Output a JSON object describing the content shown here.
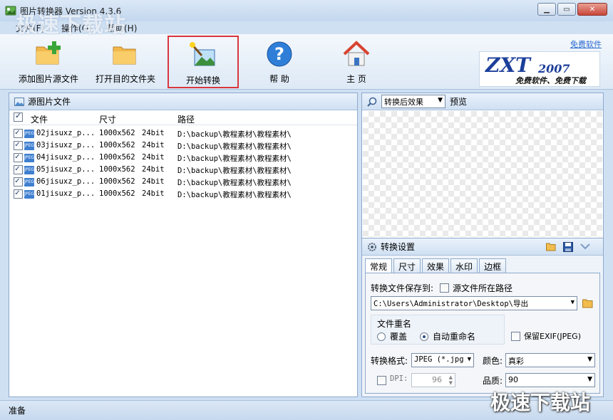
{
  "window": {
    "title": "图片转换器 Version 4.3.6"
  },
  "menu": {
    "file": "文件(F)",
    "operate": "操作(O)",
    "help": "帮助(H)"
  },
  "toolbar": {
    "add_source": "添加图片源文件",
    "open_target": "打开目的文件夹",
    "start_convert": "开始转换",
    "help": "帮 助",
    "home": "主 页",
    "free_link": "免费软件"
  },
  "logo": {
    "main": "ZXT",
    "year": "2007",
    "sub": "免费软件、免费下载"
  },
  "watermark": {
    "top": "极速下载站",
    "bottom": "极速下载站"
  },
  "source_panel": {
    "title": "源图片文件",
    "columns": {
      "file": "文件",
      "size": "尺寸",
      "path": "路径"
    },
    "rows": [
      {
        "checked": true,
        "icon": "jpeg-icon",
        "name": "02jisuxz_p...",
        "size": "1000x562",
        "depth": "24bit",
        "path": "D:\\backup\\教程素材\\教程素材\\"
      },
      {
        "checked": true,
        "icon": "jpeg-icon",
        "name": "03jisuxz_p...",
        "size": "1000x562",
        "depth": "24bit",
        "path": "D:\\backup\\教程素材\\教程素材\\"
      },
      {
        "checked": true,
        "icon": "jpeg-icon",
        "name": "04jisuxz_p...",
        "size": "1000x562",
        "depth": "24bit",
        "path": "D:\\backup\\教程素材\\教程素材\\"
      },
      {
        "checked": true,
        "icon": "jpeg-icon",
        "name": "05jisuxz_p...",
        "size": "1000x562",
        "depth": "24bit",
        "path": "D:\\backup\\教程素材\\教程素材\\"
      },
      {
        "checked": true,
        "icon": "jpeg-icon",
        "name": "06jisuxz_p...",
        "size": "1000x562",
        "depth": "24bit",
        "path": "D:\\backup\\教程素材\\教程素材\\"
      },
      {
        "checked": true,
        "icon": "jpeg-icon",
        "name": "01jisuxz_p...",
        "size": "1000x562",
        "depth": "24bit",
        "path": "D:\\backup\\教程素材\\教程素材\\"
      }
    ]
  },
  "preview_panel": {
    "mode_selected": "转换后效果",
    "label": "预览"
  },
  "settings": {
    "title": "转换设置",
    "tabs": [
      "常规",
      "尺寸",
      "效果",
      "水印",
      "边框"
    ],
    "active_tab": "常规",
    "save_to_label": "转换文件保存到:",
    "source_path_label": "源文件所在路径",
    "source_path_checked": false,
    "save_path": "C:\\Users\\Administrator\\Desktop\\导出",
    "rename_group": "文件重名",
    "overwrite_label": "覆盖",
    "auto_rename_label": "自动重命名",
    "rename_selected": "auto_rename",
    "keep_exif_label": "保留EXIF(JPEG)",
    "keep_exif_checked": false,
    "format_label": "转换格式:",
    "format_value": "JPEG (*.jpg",
    "color_label": "颜色:",
    "color_value": "真彩",
    "dpi_label": "DPI:",
    "dpi_value": "96",
    "dpi_checked": false,
    "quality_label": "品质:",
    "quality_value": "90"
  },
  "status": {
    "text": "准备"
  }
}
